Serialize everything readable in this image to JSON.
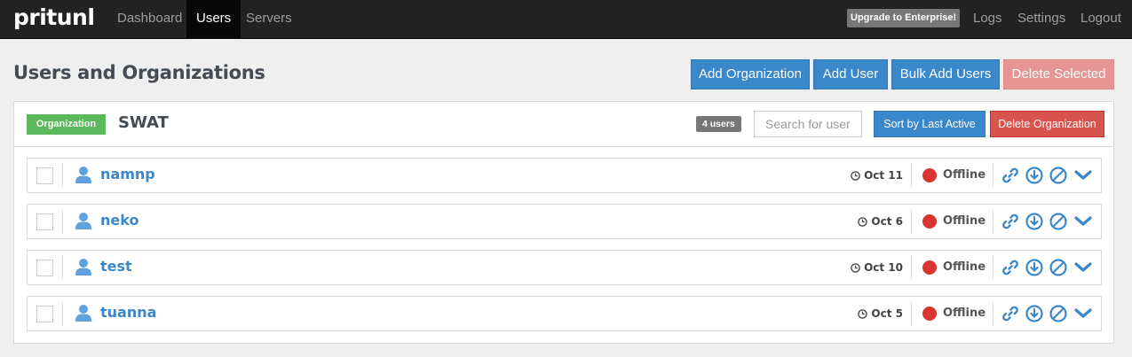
{
  "navbar": {
    "brand": "pritunl",
    "links": [
      "Dashboard",
      "Users",
      "Servers"
    ],
    "upgrade": "Upgrade to Enterprise!",
    "right_links": [
      "Logs",
      "Settings",
      "Logout"
    ]
  },
  "header": {
    "title": "Users and Organizations",
    "add_org": "Add Organization",
    "add_user": "Add User",
    "bulk_add": "Bulk Add Users",
    "delete_selected": "Delete Selected"
  },
  "organization": {
    "label": "Organization",
    "name": "SWAT",
    "user_count": "4 users",
    "search_placeholder": "Search for user",
    "sort_label": "Sort by Last Active",
    "delete_label": "Delete Organization",
    "users": [
      {
        "name": "namnp",
        "last_active": "Oct 11",
        "status": "Offline"
      },
      {
        "name": "neko",
        "last_active": "Oct 6",
        "status": "Offline"
      },
      {
        "name": "test",
        "last_active": "Oct 10",
        "status": "Offline"
      },
      {
        "name": "tuanna",
        "last_active": "Oct 5",
        "status": "Offline"
      }
    ]
  },
  "icons": {
    "user": "user-icon",
    "clock": "clock-icon",
    "link": "link-icon",
    "download": "download-icon",
    "disable": "disable-icon",
    "expand": "chevron-down-icon"
  },
  "colors": {
    "navbar": "#222222",
    "primary": "#3a87c9",
    "danger": "#d9534f",
    "success": "#5cb85c",
    "offline": "#d9342f"
  }
}
